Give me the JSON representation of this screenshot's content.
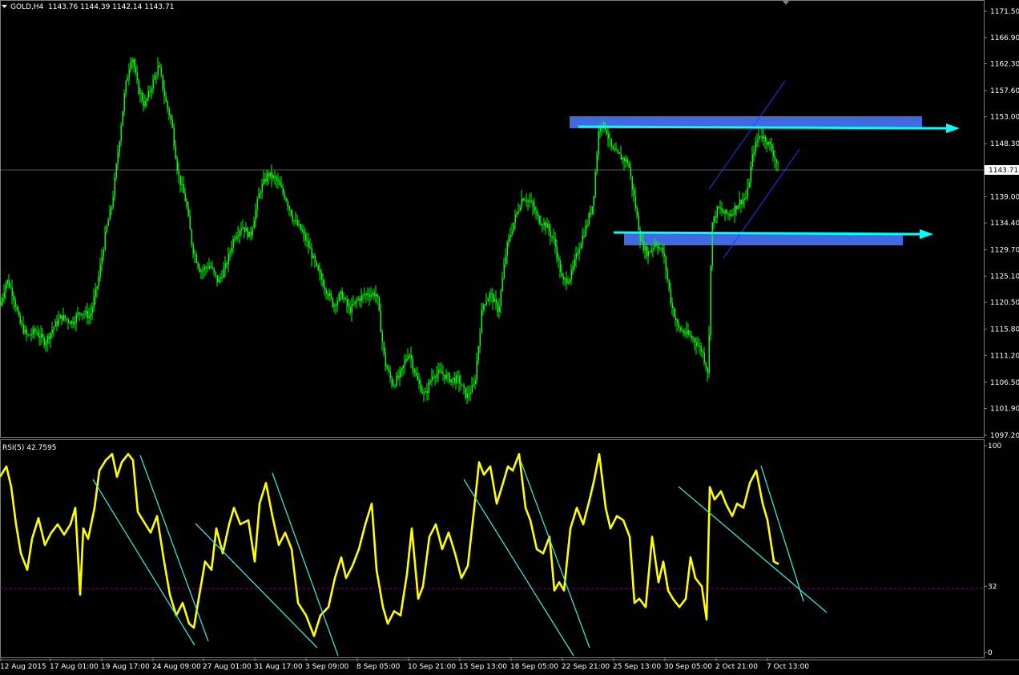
{
  "header": {
    "symbol_label": "GOLD,H4",
    "ohlc": "1143.76 1144.39 1142.14 1143.71"
  },
  "colors": {
    "background": "#000000",
    "candles": "#00ff00",
    "rsi_line": "#ffff00",
    "trend_lines": "#40e0d0",
    "zone": "#4169e1",
    "arrow": "#00ffff",
    "channel": "#1e3cff",
    "level_line": "#800080"
  },
  "chart_data": [
    {
      "type": "candlestick",
      "title": "GOLD,H4",
      "ylim": [
        1097.2,
        1173.5
      ],
      "price_ticks": [
        "1171.50",
        "1166.90",
        "1162.30",
        "1157.60",
        "1153.00",
        "1148.30",
        "1143.71",
        "1139.00",
        "1134.40",
        "1129.70",
        "1125.10",
        "1120.50",
        "1115.80",
        "1111.20",
        "1106.50",
        "1101.90",
        "1097.20"
      ],
      "current_price": "1143.71",
      "x_ticks": [
        "12 Aug 2015",
        "17 Aug 01:00",
        "19 Aug 17:00",
        "24 Aug 09:00",
        "27 Aug 01:00",
        "31 Aug 17:00",
        "3 Sep 09:00",
        "8 Sep 05:00",
        "10 Sep 21:00",
        "15 Sep 13:00",
        "18 Sep 05:00",
        "22 Sep 21:00",
        "25 Sep 13:00",
        "30 Sep 05:00",
        "2 Oct 21:00",
        "7 Oct 13:00"
      ],
      "close_path": [
        [
          0,
          1120
        ],
        [
          8,
          1124.5
        ],
        [
          16,
          1122
        ],
        [
          24,
          1117
        ],
        [
          34,
          1114.5
        ],
        [
          44,
          1115.5
        ],
        [
          56,
          1113.5
        ],
        [
          66,
          1116
        ],
        [
          76,
          1118
        ],
        [
          90,
          1117
        ],
        [
          100,
          1119
        ],
        [
          112,
          1118
        ],
        [
          122,
          1124
        ],
        [
          132,
          1133
        ],
        [
          140,
          1138
        ],
        [
          148,
          1148
        ],
        [
          156,
          1158
        ],
        [
          164,
          1164
        ],
        [
          172,
          1158
        ],
        [
          180,
          1155
        ],
        [
          188,
          1158
        ],
        [
          198,
          1162
        ],
        [
          206,
          1156
        ],
        [
          214,
          1152
        ],
        [
          222,
          1143
        ],
        [
          232,
          1138
        ],
        [
          240,
          1130
        ],
        [
          250,
          1126
        ],
        [
          262,
          1127
        ],
        [
          272,
          1124
        ],
        [
          282,
          1127
        ],
        [
          292,
          1132
        ],
        [
          302,
          1134
        ],
        [
          312,
          1132
        ],
        [
          324,
          1140
        ],
        [
          334,
          1143
        ],
        [
          344,
          1142
        ],
        [
          356,
          1139
        ],
        [
          366,
          1135
        ],
        [
          376,
          1133
        ],
        [
          386,
          1130
        ],
        [
          396,
          1126
        ],
        [
          406,
          1123
        ],
        [
          416,
          1120
        ],
        [
          426,
          1122
        ],
        [
          436,
          1119
        ],
        [
          446,
          1121
        ],
        [
          458,
          1122
        ],
        [
          470,
          1122
        ],
        [
          480,
          1110
        ],
        [
          490,
          1106
        ],
        [
          500,
          1108
        ],
        [
          510,
          1112
        ],
        [
          520,
          1107
        ],
        [
          530,
          1104
        ],
        [
          540,
          1108
        ],
        [
          552,
          1108
        ],
        [
          562,
          1107
        ],
        [
          572,
          1107
        ],
        [
          582,
          1104
        ],
        [
          592,
          1106
        ],
        [
          602,
          1120
        ],
        [
          612,
          1122
        ],
        [
          622,
          1119
        ],
        [
          632,
          1130
        ],
        [
          642,
          1135
        ],
        [
          652,
          1139
        ],
        [
          662,
          1138
        ],
        [
          672,
          1135
        ],
        [
          682,
          1134
        ],
        [
          692,
          1131
        ],
        [
          702,
          1124
        ],
        [
          712,
          1125
        ],
        [
          722,
          1130
        ],
        [
          732,
          1134
        ],
        [
          740,
          1138
        ],
        [
          748,
          1152
        ],
        [
          756,
          1151
        ],
        [
          764,
          1147
        ],
        [
          774,
          1146
        ],
        [
          784,
          1145
        ],
        [
          792,
          1138
        ],
        [
          800,
          1131
        ],
        [
          808,
          1129
        ],
        [
          818,
          1131
        ],
        [
          828,
          1129
        ],
        [
          838,
          1120
        ],
        [
          846,
          1116
        ],
        [
          856,
          1115
        ],
        [
          866,
          1114
        ],
        [
          876,
          1112
        ],
        [
          884,
          1108
        ],
        [
          888,
          1134
        ],
        [
          896,
          1137
        ],
        [
          904,
          1136
        ],
        [
          912,
          1136
        ],
        [
          922,
          1138
        ],
        [
          932,
          1139
        ],
        [
          940,
          1147
        ],
        [
          948,
          1150
        ],
        [
          956,
          1149
        ],
        [
          964,
          1147
        ],
        [
          972,
          1143.7
        ]
      ]
    },
    {
      "type": "line",
      "title": "RSI(5) 42.7595",
      "ylim": [
        0,
        100
      ],
      "y_ticks": [
        "100",
        "32",
        "0"
      ],
      "level": 32,
      "series": [
        {
          "name": "RSI(5)",
          "points": [
            [
              0,
              85
            ],
            [
              8,
              90
            ],
            [
              14,
              80
            ],
            [
              20,
              62
            ],
            [
              26,
              48
            ],
            [
              34,
              40
            ],
            [
              40,
              55
            ],
            [
              48,
              65
            ],
            [
              56,
              52
            ],
            [
              64,
              58
            ],
            [
              72,
              62
            ],
            [
              80,
              57
            ],
            [
              88,
              62
            ],
            [
              94,
              70
            ],
            [
              100,
              28
            ],
            [
              104,
              60
            ],
            [
              110,
              55
            ],
            [
              118,
              70
            ],
            [
              124,
              88
            ],
            [
              132,
              93
            ],
            [
              140,
              96
            ],
            [
              146,
              85
            ],
            [
              152,
              92
            ],
            [
              160,
              96
            ],
            [
              166,
              93
            ],
            [
              172,
              68
            ],
            [
              180,
              63
            ],
            [
              188,
              58
            ],
            [
              196,
              66
            ],
            [
              204,
              46
            ],
            [
              212,
              28
            ],
            [
              220,
              18
            ],
            [
              228,
              24
            ],
            [
              236,
              14
            ],
            [
              242,
              12
            ],
            [
              248,
              26
            ],
            [
              256,
              44
            ],
            [
              264,
              40
            ],
            [
              270,
              60
            ],
            [
              278,
              48
            ],
            [
              286,
              62
            ],
            [
              292,
              70
            ],
            [
              300,
              62
            ],
            [
              310,
              64
            ],
            [
              318,
              44
            ],
            [
              324,
              72
            ],
            [
              332,
              82
            ],
            [
              340,
              66
            ],
            [
              348,
              52
            ],
            [
              356,
              58
            ],
            [
              364,
              50
            ],
            [
              372,
              24
            ],
            [
              382,
              18
            ],
            [
              392,
              8
            ],
            [
              400,
              18
            ],
            [
              410,
              22
            ],
            [
              418,
              36
            ],
            [
              426,
              46
            ],
            [
              432,
              36
            ],
            [
              440,
              42
            ],
            [
              448,
              50
            ],
            [
              456,
              62
            ],
            [
              464,
              72
            ],
            [
              470,
              40
            ],
            [
              478,
              22
            ],
            [
              484,
              14
            ],
            [
              492,
              20
            ],
            [
              500,
              18
            ],
            [
              508,
              38
            ],
            [
              514,
              60
            ],
            [
              522,
              26
            ],
            [
              528,
              32
            ],
            [
              536,
              56
            ],
            [
              544,
              62
            ],
            [
              552,
              50
            ],
            [
              560,
              58
            ],
            [
              568,
              48
            ],
            [
              576,
              36
            ],
            [
              584,
              42
            ],
            [
              592,
              70
            ],
            [
              598,
              92
            ],
            [
              604,
              86
            ],
            [
              612,
              90
            ],
            [
              620,
              72
            ],
            [
              628,
              82
            ],
            [
              634,
              90
            ],
            [
              640,
              88
            ],
            [
              648,
              96
            ],
            [
              656,
              70
            ],
            [
              662,
              64
            ],
            [
              670,
              50
            ],
            [
              678,
              48
            ],
            [
              686,
              56
            ],
            [
              692,
              30
            ],
            [
              698,
              34
            ],
            [
              704,
              30
            ],
            [
              712,
              60
            ],
            [
              720,
              70
            ],
            [
              728,
              62
            ],
            [
              736,
              74
            ],
            [
              742,
              84
            ],
            [
              748,
              96
            ],
            [
              756,
              70
            ],
            [
              762,
              60
            ],
            [
              770,
              66
            ],
            [
              778,
              64
            ],
            [
              786,
              56
            ],
            [
              792,
              24
            ],
            [
              798,
              26
            ],
            [
              806,
              22
            ],
            [
              814,
              56
            ],
            [
              822,
              34
            ],
            [
              828,
              44
            ],
            [
              834,
              30
            ],
            [
              840,
              26
            ],
            [
              848,
              22
            ],
            [
              856,
              26
            ],
            [
              862,
              46
            ],
            [
              868,
              36
            ],
            [
              876,
              32
            ],
            [
              882,
              16
            ],
            [
              886,
              80
            ],
            [
              892,
              74
            ],
            [
              900,
              78
            ],
            [
              906,
              72
            ],
            [
              914,
              66
            ],
            [
              920,
              72
            ],
            [
              928,
              70
            ],
            [
              936,
              82
            ],
            [
              944,
              88
            ],
            [
              952,
              72
            ],
            [
              958,
              64
            ],
            [
              966,
              44
            ],
            [
              972,
              42.76
            ]
          ]
        }
      ]
    }
  ]
}
